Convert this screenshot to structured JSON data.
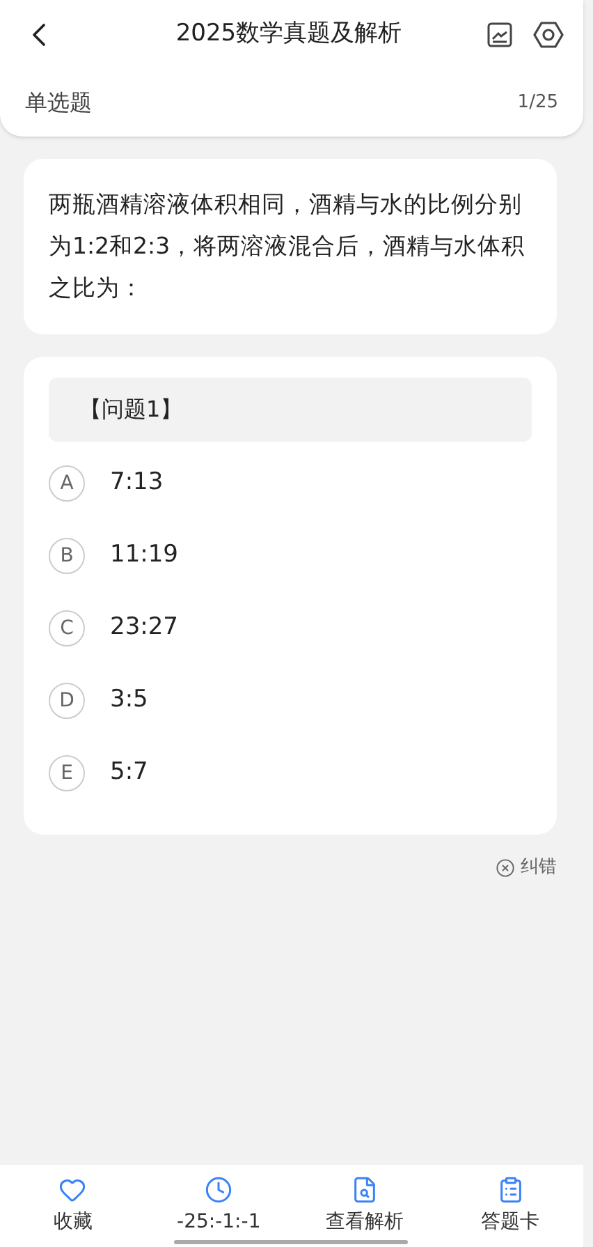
{
  "header": {
    "title": "2025数学真题及解析",
    "section": "单选题",
    "progress": "1/25"
  },
  "question": {
    "text": "两瓶酒精溶液体积相同，酒精与水的比例分别为1:2和2:3，将两溶液混合后，酒精与水体积之比为："
  },
  "options_card": {
    "heading": "【问题1】",
    "options": [
      {
        "letter": "A",
        "text": "7:13",
        "selected": false
      },
      {
        "letter": "B",
        "text": "11:19",
        "selected": false
      },
      {
        "letter": "C",
        "text": "23:27",
        "selected": false
      },
      {
        "letter": "D",
        "text": "3:5",
        "selected": false
      },
      {
        "letter": "E",
        "text": "5:7",
        "selected": false
      }
    ]
  },
  "report": {
    "label": "纠错"
  },
  "bottom_bar": [
    {
      "kind": "favorite",
      "label": "收藏"
    },
    {
      "kind": "timer",
      "label": "-25:-1:-1"
    },
    {
      "kind": "analysis",
      "label": "查看解析"
    },
    {
      "kind": "answer_card",
      "label": "答题卡"
    }
  ]
}
